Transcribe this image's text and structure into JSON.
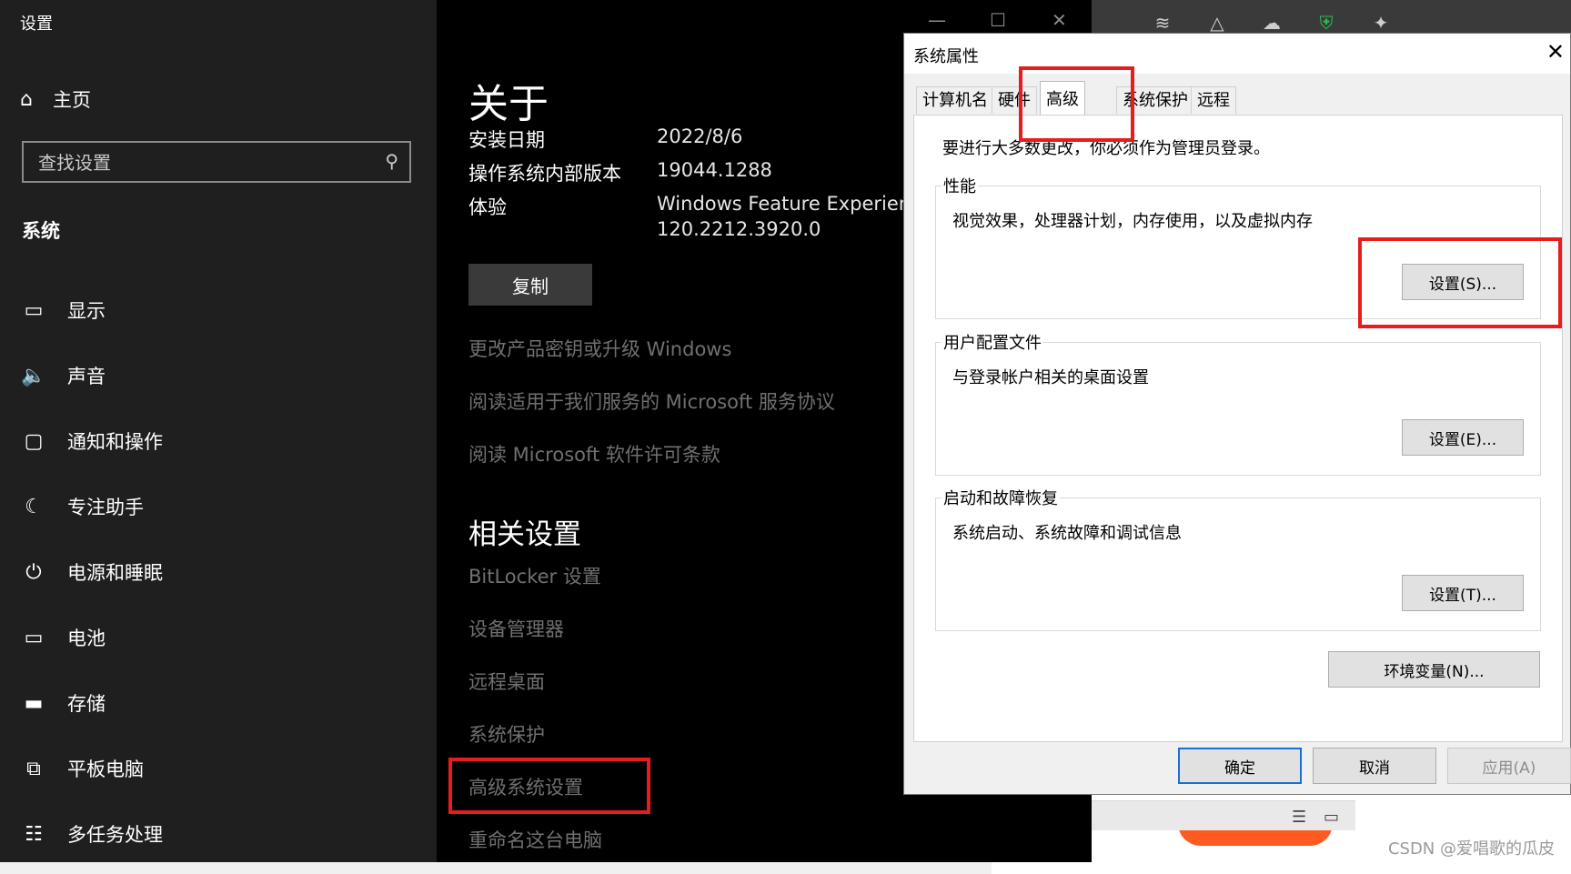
{
  "settings": {
    "window_title": "设置",
    "home_label": "主页",
    "search_placeholder": "查找设置",
    "section_label": "系统",
    "nav_items": [
      {
        "label": "显示",
        "icon": "display-icon"
      },
      {
        "label": "声音",
        "icon": "sound-icon"
      },
      {
        "label": "通知和操作",
        "icon": "notification-icon"
      },
      {
        "label": "专注助手",
        "icon": "moon-icon"
      },
      {
        "label": "电源和睡眠",
        "icon": "power-icon"
      },
      {
        "label": "电池",
        "icon": "battery-icon"
      },
      {
        "label": "存储",
        "icon": "storage-icon"
      },
      {
        "label": "平板电脑",
        "icon": "tablet-icon"
      },
      {
        "label": "多任务处理",
        "icon": "multitask-icon"
      }
    ]
  },
  "about": {
    "heading": "关于",
    "rows": [
      {
        "key": "安装日期",
        "value": "2022/8/6"
      },
      {
        "key": "操作系统内部版本",
        "value": "19044.1288"
      },
      {
        "key": "体验",
        "value": "Windows Feature Experience"
      }
    ],
    "experience_version": "120.2212.3920.0",
    "copy_label": "复制",
    "links": [
      "更改产品密钥或升级 Windows",
      "阅读适用于我们服务的 Microsoft 服务协议",
      "阅读 Microsoft 软件许可条款"
    ],
    "related_heading": "相关设置",
    "related_links": [
      "BitLocker 设置",
      "设备管理器",
      "远程桌面",
      "系统保护",
      "高级系统设置",
      "重命名这台电脑"
    ]
  },
  "dialog": {
    "title": "系统属性",
    "tabs": [
      "计算机名",
      "硬件",
      "高级",
      "系统保护",
      "远程"
    ],
    "active_tab": "高级",
    "notice": "要进行大多数更改，你必须作为管理员登录。",
    "groups": [
      {
        "legend": "性能",
        "desc": "视觉效果，处理器计划，内存使用，以及虚拟内存",
        "button": "设置(S)..."
      },
      {
        "legend": "用户配置文件",
        "desc": "与登录帐户相关的桌面设置",
        "button": "设置(E)..."
      },
      {
        "legend": "启动和故障恢复",
        "desc": "系统启动、系统故障和调试信息",
        "button": "设置(T)..."
      }
    ],
    "env_button": "环境变量(N)...",
    "ok": "确定",
    "cancel": "取消",
    "apply": "应用(A)"
  },
  "watermark": "CSDN @爱唱歌的瓜皮",
  "colors": {
    "highlight": "#e81c1c",
    "primary_border": "#1a6fd4"
  }
}
